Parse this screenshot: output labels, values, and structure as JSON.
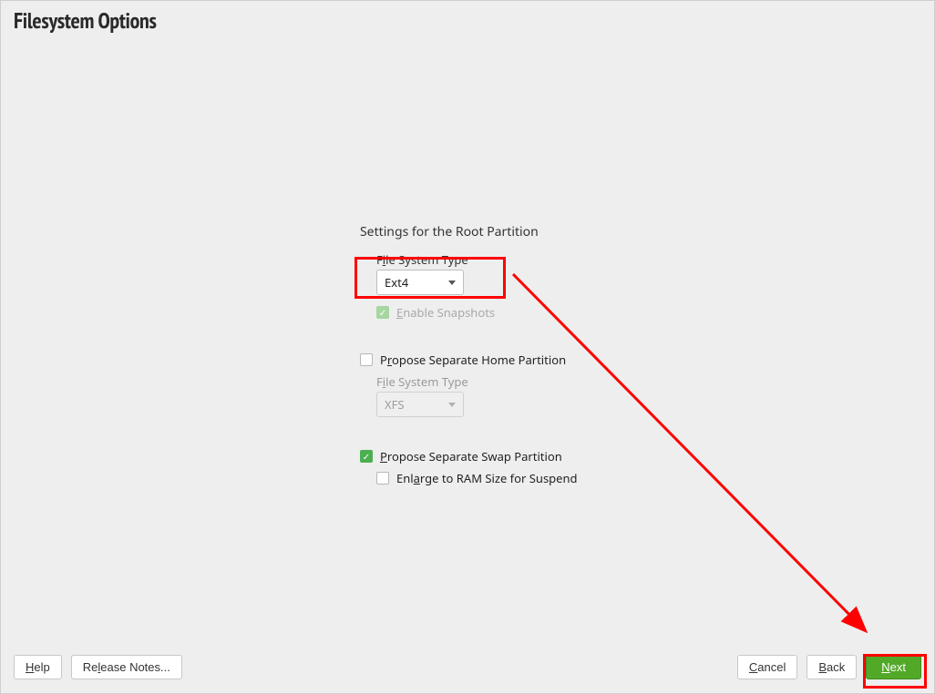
{
  "title": "Filesystem Options",
  "root": {
    "section_header": "Settings for the Root Partition",
    "fs_label": "File System Type",
    "fs_value": "Ext4",
    "snapshots_label": "Enable Snapshots"
  },
  "home": {
    "checkbox_label": "Propose Separate Home Partition",
    "fs_label": "File System Type",
    "fs_value": "XFS"
  },
  "swap": {
    "checkbox_label": "Propose Separate Swap Partition",
    "enlarge_label": "Enlarge to RAM Size for Suspend"
  },
  "buttons": {
    "help": "Help",
    "release_notes": "Release Notes...",
    "cancel": "Cancel",
    "back": "Back",
    "next": "Next"
  }
}
